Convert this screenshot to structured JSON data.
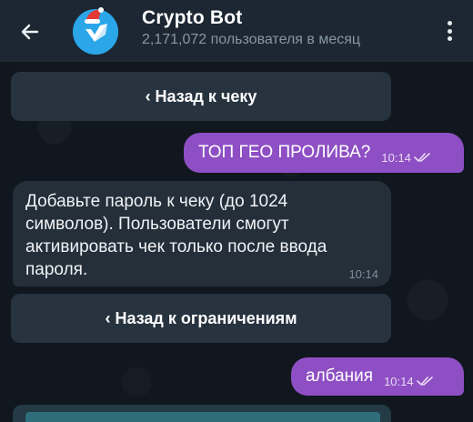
{
  "header": {
    "title": "Crypto Bot",
    "subtitle": "2,171,072 пользователя в месяц"
  },
  "buttons": {
    "back_to_check": "‹ Назад к чеку",
    "back_to_limits": "‹ Назад к ограничениям"
  },
  "messages": [
    {
      "direction": "out",
      "text": "ТОП ГЕО ПРОЛИВА?",
      "time": "10:14",
      "status": "read"
    },
    {
      "direction": "in",
      "text": "Добавьте пароль к чеку (до 1024 символов). Пользователи смогут активировать чек только после ввода пароля.",
      "time": "10:14"
    },
    {
      "direction": "out",
      "text": "албания",
      "time": "10:14",
      "status": "read"
    }
  ],
  "colors": {
    "header_bg": "#1c2733",
    "outgoing_bubble": "#8e4fc4",
    "incoming_bubble": "#252f3a",
    "inline_button": "#27333f",
    "avatar": "#2aa6e9"
  },
  "icons": {
    "back": "arrow-left-icon",
    "menu": "more-vertical-icon",
    "read_status": "double-check-icon",
    "avatar": "crypto-bot-logo"
  }
}
